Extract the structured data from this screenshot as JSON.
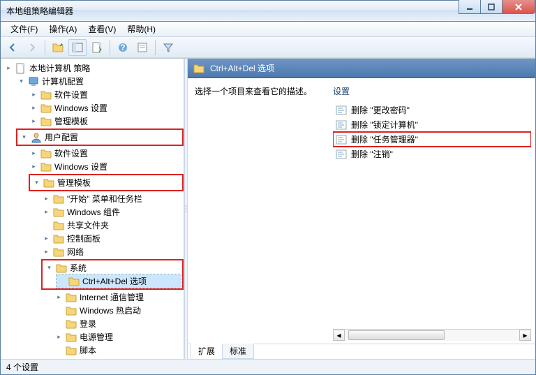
{
  "window": {
    "title": "本地组策略编辑器"
  },
  "menu": {
    "file": "文件(F)",
    "action": "操作(A)",
    "view": "查看(V)",
    "help": "帮助(H)"
  },
  "tree": {
    "root": "本地计算机 策略",
    "computer": "计算机配置",
    "c_soft": "软件设置",
    "c_win": "Windows 设置",
    "c_admin": "管理模板",
    "user": "用户配置",
    "u_soft": "软件设置",
    "u_win": "Windows 设置",
    "u_admin": "管理模板",
    "start_taskbar": "\"开始\" 菜单和任务栏",
    "win_comp": "Windows 组件",
    "shared": "共享文件夹",
    "control": "控制面板",
    "network": "网络",
    "system": "系统",
    "cad": "Ctrl+Alt+Del 选项",
    "inet": "Internet 通信管理",
    "hotboot": "Windows 热启动",
    "logon": "登录",
    "power": "电源管理",
    "scripts": "脚本"
  },
  "right": {
    "header": "Ctrl+Alt+Del 选项",
    "desc": "选择一个项目来查看它的描述。",
    "list_header": "设置",
    "items": [
      "删除 \"更改密码\"",
      "删除 \"锁定计算机\"",
      "删除 \"任务管理器\"",
      "删除 \"注销\""
    ]
  },
  "tabs": {
    "ext": "扩展",
    "std": "标准"
  },
  "status": "4 个设置"
}
